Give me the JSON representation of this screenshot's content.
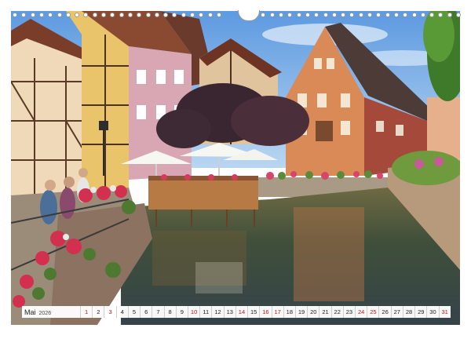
{
  "calendar": {
    "month": "Mai",
    "year": "2026",
    "days": [
      {
        "n": "1",
        "red": true
      },
      {
        "n": "2",
        "red": false
      },
      {
        "n": "3",
        "red": true
      },
      {
        "n": "4",
        "red": false
      },
      {
        "n": "5",
        "red": false
      },
      {
        "n": "6",
        "red": false
      },
      {
        "n": "7",
        "red": false
      },
      {
        "n": "8",
        "red": false
      },
      {
        "n": "9",
        "red": false
      },
      {
        "n": "10",
        "red": true
      },
      {
        "n": "11",
        "red": false
      },
      {
        "n": "12",
        "red": false
      },
      {
        "n": "13",
        "red": false
      },
      {
        "n": "14",
        "red": true
      },
      {
        "n": "15",
        "red": false
      },
      {
        "n": "16",
        "red": true
      },
      {
        "n": "17",
        "red": true
      },
      {
        "n": "18",
        "red": false
      },
      {
        "n": "19",
        "red": false
      },
      {
        "n": "20",
        "red": false
      },
      {
        "n": "21",
        "red": false
      },
      {
        "n": "22",
        "red": false
      },
      {
        "n": "23",
        "red": false
      },
      {
        "n": "24",
        "red": true
      },
      {
        "n": "25",
        "red": true
      },
      {
        "n": "26",
        "red": false
      },
      {
        "n": "27",
        "red": false
      },
      {
        "n": "28",
        "red": false
      },
      {
        "n": "29",
        "red": false
      },
      {
        "n": "30",
        "red": false
      },
      {
        "n": "31",
        "red": true
      }
    ]
  },
  "colors": {
    "sky": "#7fb4e6",
    "water": "#4a5a3e",
    "orange_house": "#d98a56",
    "holiday_red": "#c0161f"
  }
}
